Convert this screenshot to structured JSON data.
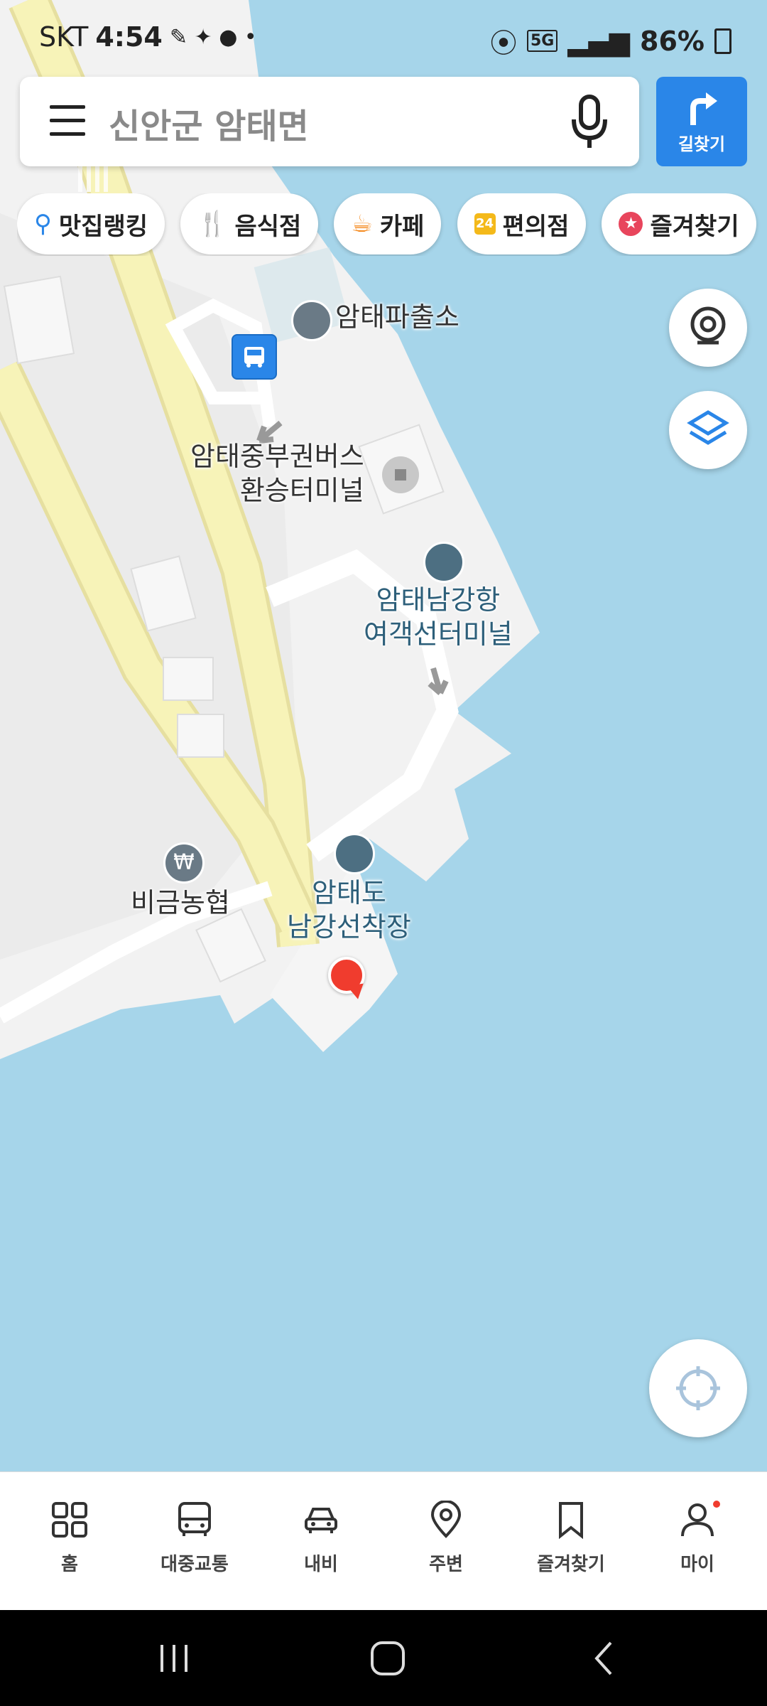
{
  "status": {
    "carrier": "SKT",
    "time": "4:54",
    "network": "5G",
    "battery": "86%"
  },
  "search": {
    "query": "신안군 암태면",
    "route_label": "길찾기"
  },
  "chips": [
    {
      "label": "맛집랭킹",
      "icon": "map-pin-rank-icon"
    },
    {
      "label": "음식점",
      "icon": "restaurant-icon"
    },
    {
      "label": "카페",
      "icon": "cafe-icon"
    },
    {
      "label": "편의점",
      "icon": "convenience-store-icon"
    },
    {
      "label": "즐겨찾기",
      "icon": "star-icon"
    }
  ],
  "map": {
    "labels": {
      "police": "암태파출소",
      "bus_terminal_line1": "암태중부권버스",
      "bus_terminal_line2": "환승터미널",
      "ferry_terminal_line1": "암태남강항",
      "ferry_terminal_line2": "여객선터미널",
      "bank": "비금농협",
      "dock_line1": "암태도",
      "dock_line2": "남강선착장"
    },
    "colors": {
      "water": "#a6d5ea",
      "land": "#f2f2f2",
      "road": "#f7f3b8",
      "accent": "#2a86e8",
      "location_dot": "#f03c2e"
    }
  },
  "nav": [
    {
      "label": "홈",
      "icon": "home-grid-icon"
    },
    {
      "label": "대중교통",
      "icon": "bus-icon"
    },
    {
      "label": "내비",
      "icon": "car-icon"
    },
    {
      "label": "주변",
      "icon": "location-pin-icon"
    },
    {
      "label": "즐겨찾기",
      "icon": "bookmark-icon"
    },
    {
      "label": "마이",
      "icon": "person-icon"
    }
  ]
}
